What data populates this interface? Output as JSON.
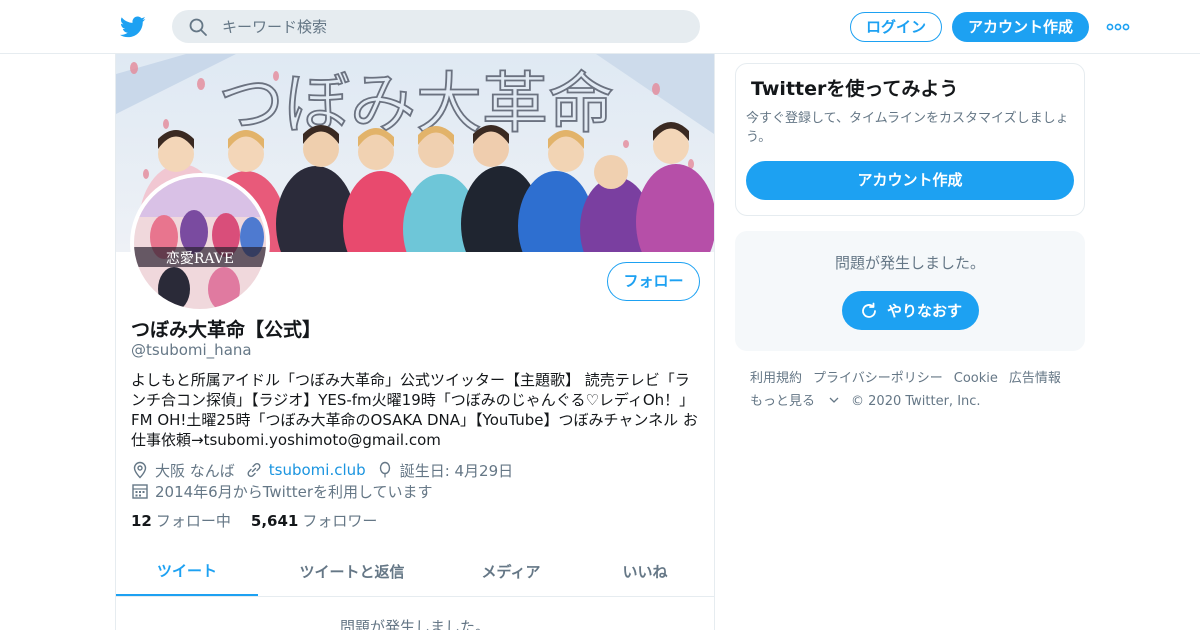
{
  "header": {
    "search_placeholder": "キーワード検索",
    "login_label": "ログイン",
    "signup_label": "アカウント作成",
    "accent": "#1da1f2"
  },
  "profile": {
    "name": "つぼみ大革命【公式】",
    "handle": "@tsubomi_hana",
    "follow_label": "フォロー",
    "banner_text": "つぼみ大革命",
    "bio_lines": [
      "よしもと所属アイドル「つぼみ大革命」公式ツイッター【主題歌】 読売テレビ「ラ",
      "ンチ合コン探偵」【ラジオ】YES-fm火曜19時「つぼみのじゃんぐる♡レディOh！」",
      "FM OH!土曜25時「つぼみ大革命のOSAKA DNA」【YouTube】つぼみチャンネル お",
      "仕事依頼→tsubomi.yoshimoto@gmail.com"
    ],
    "location": "大阪 なんば",
    "url": "tsubomi.club",
    "birthday": "誕生日: 4月29日",
    "joined": "2014年6月からTwitterを利用しています",
    "following_count": "12",
    "following_label": "フォロー中",
    "followers_count": "5,641",
    "followers_label": "フォロワー",
    "icons": [
      "location-icon",
      "link-icon",
      "balloon-icon",
      "calendar-icon"
    ]
  },
  "tabs": [
    {
      "label": "ツイート",
      "active": true
    },
    {
      "label": "ツイートと返信",
      "active": false
    },
    {
      "label": "メディア",
      "active": false
    },
    {
      "label": "いいね",
      "active": false
    }
  ],
  "feed": {
    "error_text": "問題が発生しました。"
  },
  "sidebar": {
    "card_title": "Twitterを使ってみよう",
    "card_desc": "今すぐ登録して、タイムラインをカスタマイズしましょう。",
    "card_cta": "アカウント作成",
    "error_text": "問題が発生しました。",
    "retry_label": "やりなおす"
  },
  "footer": {
    "links": [
      "利用規約",
      "プライバシーポリシー",
      "Cookie",
      "広告情報",
      "もっと見る"
    ],
    "copyright": "© 2020 Twitter, Inc."
  }
}
